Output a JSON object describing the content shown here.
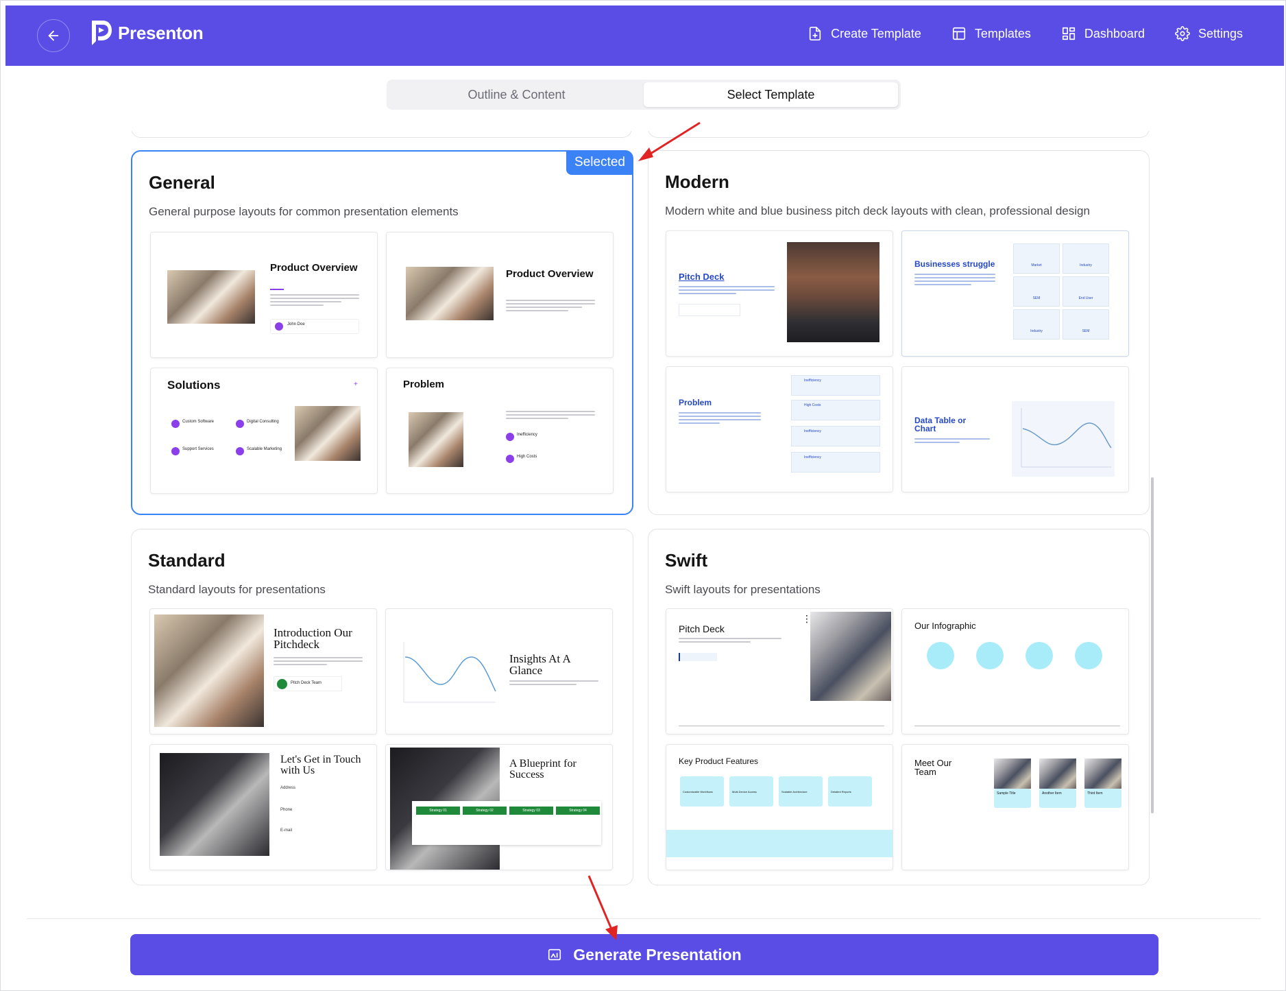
{
  "app": {
    "name": "Presenton",
    "brand_color": "#5a4de6",
    "accent_color": "#3b82f6"
  },
  "header": {
    "back_icon": "arrow-left-icon",
    "nav": [
      {
        "label": "Create Template",
        "icon": "file-plus-icon"
      },
      {
        "label": "Templates",
        "icon": "layout-icon"
      },
      {
        "label": "Dashboard",
        "icon": "grid-icon"
      },
      {
        "label": "Settings",
        "icon": "gear-icon"
      }
    ]
  },
  "tabs": [
    {
      "label": "Outline & Content",
      "active": false
    },
    {
      "label": "Select Template",
      "active": true
    }
  ],
  "templates": [
    {
      "title": "General",
      "description": "General purpose layouts for common presentation elements",
      "selected": true,
      "badge": "Selected",
      "thumbs": [
        "Product Overview",
        "Product Overview",
        "Solutions",
        "Problem"
      ],
      "solutions_items": [
        "Custom Software",
        "Digital Consulting",
        "Support Services",
        "Scalable Marketing"
      ],
      "problem_items": [
        "Inefficiency",
        "High Costs"
      ],
      "author": "John Doe"
    },
    {
      "title": "Modern",
      "description": "Modern white and blue business pitch deck layouts with clean, professional design",
      "selected": false,
      "thumbs": [
        "Pitch Deck",
        "Businesses struggle",
        "Problem",
        "Data Table or Chart"
      ],
      "struggle_items": [
        "Market",
        "Industry",
        "SEM",
        "End User",
        "Industry",
        "SEM"
      ],
      "problem_items": [
        "Inefficiency",
        "High Costs",
        "Inefficiency",
        "Inefficiency"
      ]
    },
    {
      "title": "Standard",
      "description": "Standard layouts for presentations",
      "selected": false,
      "thumbs": [
        "Introduction Our Pitchdeck",
        "Insights At A Glance",
        "Let's Get in Touch with Us",
        "A Blueprint for Success"
      ],
      "intro_team": "Pitch Deck Team",
      "contact_labels": [
        "Address",
        "Phone",
        "E-mail"
      ],
      "strategies": [
        "Strategy 01",
        "Strategy 02",
        "Strategy 03",
        "Strategy 04"
      ]
    },
    {
      "title": "Swift",
      "description": "Swift layouts for presentations",
      "selected": false,
      "thumbs": [
        "Pitch Deck",
        "Our Infographic",
        "Key Product Features",
        "Meet Our Team"
      ],
      "features": [
        "Customizable Workflows",
        "Multi-Device Access",
        "Scalable Architecture",
        "Detailed Reports"
      ],
      "team": [
        "Sample Title",
        "Another Item",
        "Third Item"
      ]
    }
  ],
  "footer": {
    "button_label": "Generate Presentation",
    "button_icon": "ai-image-icon"
  }
}
